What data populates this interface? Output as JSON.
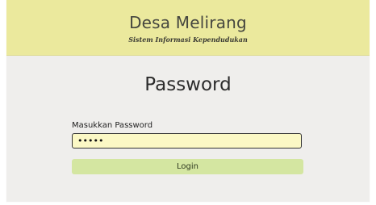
{
  "header": {
    "title": "Desa Melirang",
    "subtitle": "Sistem Informasi Kependudukan"
  },
  "login": {
    "heading": "Password",
    "field_label": "Masukkan Password",
    "password_value": "•••••",
    "button_label": "Login"
  },
  "colors": {
    "header_bg": "#ebe99d",
    "page_bg": "#efeeec",
    "input_bg": "#fbf8c5",
    "button_bg": "#d4e6a1"
  }
}
